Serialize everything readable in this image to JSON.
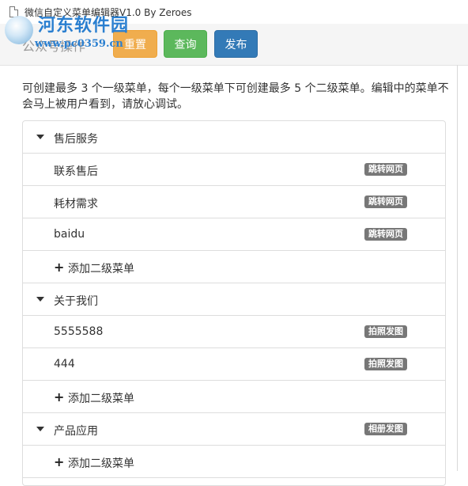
{
  "window": {
    "title": "微信自定义菜单编辑器V1.0 By Zeroes"
  },
  "watermark": {
    "name": "河东软件园",
    "url": "www.pc0359.cn"
  },
  "toolbar": {
    "heading": "公众号操作",
    "buttons": {
      "reset": "重置",
      "query": "查询",
      "publish": "发布"
    }
  },
  "help_text": "可创建最多 3 个一级菜单，每个一级菜单下可创建最多 5 个二级菜单。编辑中的菜单不会马上被用户看到，请放心调试。",
  "menu": {
    "add_sub_label": "添加二级菜单",
    "groups": [
      {
        "name": "售后服务",
        "badge": "",
        "items": [
          {
            "name": "联系售后",
            "badge": "跳转网页"
          },
          {
            "name": "耗材需求",
            "badge": "跳转网页"
          },
          {
            "name": "baidu",
            "badge": "跳转网页"
          }
        ]
      },
      {
        "name": "关于我们",
        "badge": "",
        "items": [
          {
            "name": "5555588",
            "badge": "拍照发图"
          },
          {
            "name": "444",
            "badge": "拍照发图"
          }
        ]
      },
      {
        "name": "产品应用",
        "badge": "相册发图",
        "items": []
      }
    ]
  },
  "colors": {
    "orange": "#f0ad4e",
    "green": "#5cb85c",
    "blue": "#337ab7",
    "badge": "#777777"
  }
}
